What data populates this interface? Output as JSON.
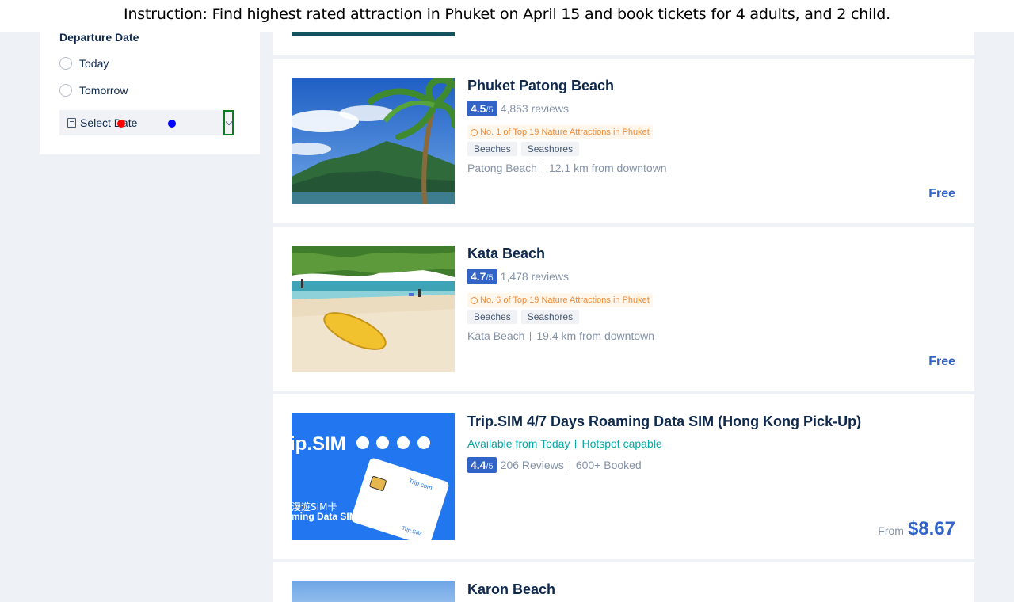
{
  "instruction": "Instruction: Find highest rated attraction in Phuket on April 15 and book tickets for 4 adults, and 2 child.",
  "filter": {
    "title": "Departure Date",
    "options": [
      "Today",
      "Tomorrow"
    ],
    "select_date_label": "Select Date"
  },
  "cards": [
    {
      "title": "Phuket Patong Beach",
      "rating": "4.5",
      "rating_out_of": "/5",
      "reviews": "4,853 reviews",
      "rank": "No. 1 of Top 19 Nature Attractions in Phuket",
      "tags": [
        "Beaches",
        "Seashores"
      ],
      "location": "Patong Beach",
      "distance": "12.1 km from downtown",
      "price": "Free"
    },
    {
      "title": "Kata Beach",
      "rating": "4.7",
      "rating_out_of": "/5",
      "reviews": "1,478 reviews",
      "rank": "No. 6 of Top 19 Nature Attractions in Phuket",
      "tags": [
        "Beaches",
        "Seashores"
      ],
      "location": "Kata Beach",
      "distance": "19.4 km from downtown",
      "price": "Free"
    },
    {
      "title": "Trip.SIM 4/7 Days Roaming Data SIM (Hong Kong Pick-Up)",
      "features": [
        "Available from Today",
        "Hotspot capable"
      ],
      "rating": "4.4",
      "rating_out_of": "/5",
      "reviews": "206 Reviews",
      "booked": "600+ Booked",
      "price_prefix": "From",
      "price": "$8.67",
      "image_text": {
        "brand": "ip.SIM",
        "card_brand": "Trip.com",
        "card_sim": "Trip.SIM",
        "cn_line": "漫遊SIM卡",
        "en_line": "ming Data SIM"
      }
    },
    {
      "title": "Karon Beach"
    }
  ],
  "colors": {
    "accent_blue": "#3264c8",
    "teal": "#07a6a6",
    "rank_orange": "#ee8c3a",
    "background": "#eef1f6"
  }
}
